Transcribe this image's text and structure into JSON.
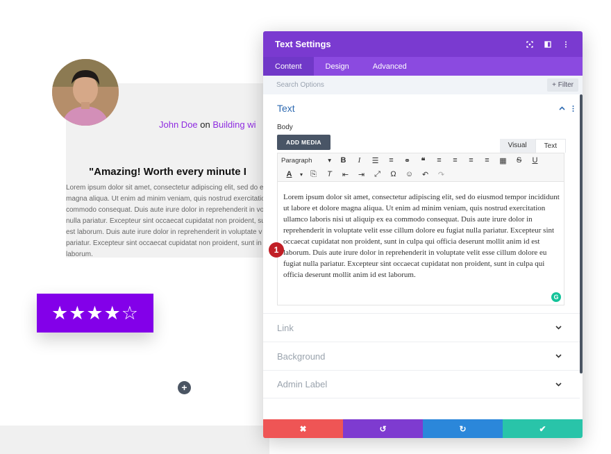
{
  "testimonial": {
    "author": "John Doe",
    "connector": "on",
    "company": "Building wi",
    "quote": "\"Amazing! Worth every minute I",
    "body": "Lorem ipsum dolor sit amet, consectetur adipiscing elit, sed do ei\nmagna aliqua. Ut enim ad minim veniam, quis nostrud exercitatio\ncommodo consequat. Duis aute irure dolor in reprehenderit in vo\nnulla pariatur. Excepteur sint occaecat cupidatat non proident, su\nest laborum. Duis aute irure dolor in reprehenderit in voluptate v\npariatur. Excepteur sint occaecat cupidatat non proident, sunt in c\nlaborum.",
    "rating": 4,
    "rating_max": 5,
    "stars_text": "★★★★☆"
  },
  "add_module": "+",
  "modal": {
    "title": "Text Settings",
    "tabs": [
      {
        "label": "Content",
        "active": true
      },
      {
        "label": "Design",
        "active": false
      },
      {
        "label": "Advanced",
        "active": false
      }
    ],
    "search_placeholder": "Search Options",
    "filter_label": "+ Filter",
    "text_section": {
      "title": "Text",
      "body_label": "Body",
      "add_media": "ADD MEDIA",
      "editor_tabs": [
        {
          "label": "Visual",
          "active": false
        },
        {
          "label": "Text",
          "active": true
        }
      ],
      "format_select": "Paragraph",
      "content": "Lorem ipsum dolor sit amet, consectetur adipiscing elit, sed do eiusmod tempor incididunt ut labore et dolore magna aliqua. Ut enim ad minim veniam, quis nostrud exercitation ullamco laboris nisi ut aliquip ex ea commodo consequat. Duis aute irure dolor in reprehenderit in voluptate velit esse cillum dolore eu fugiat nulla pariatur. Excepteur sint occaecat cupidatat non proident, sunt in culpa qui officia deserunt mollit anim id est laborum. Duis aute irure dolor in reprehenderit in voluptate velit esse cillum dolore eu fugiat nulla pariatur. Excepteur sint occaecat cupidatat non proident, sunt in culpa qui officia deserunt mollit anim id est laborum.",
      "grammarly_glyph": "G"
    },
    "step_badge": "1",
    "collapsed_sections": [
      "Link",
      "Background",
      "Admin Label"
    ],
    "actions": {
      "cancel_glyph": "✖",
      "undo_glyph": "↺",
      "redo_glyph": "↻",
      "save_glyph": "✔"
    }
  },
  "colors": {
    "header": "#7a3ad0",
    "tabs_bar": "#8b4ae0",
    "rating_bg": "#8300e9",
    "cancel": "#ef5555",
    "undo": "#7e3bd0",
    "redo": "#2b87da",
    "save": "#29c4a9",
    "accent_text": "#2e6ab1"
  }
}
